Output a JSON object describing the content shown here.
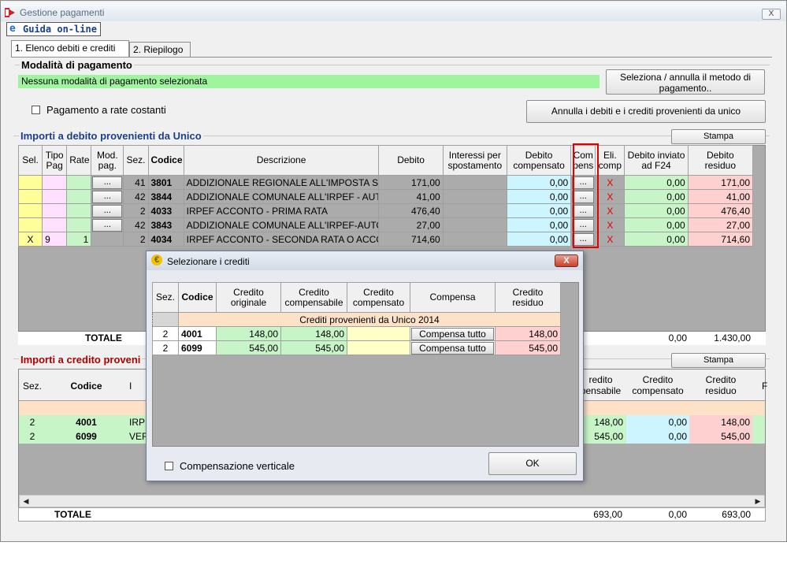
{
  "window": {
    "title": "Gestione pagamenti",
    "close_label": "X"
  },
  "toolbar": {
    "guida_label": "Guida on-line"
  },
  "tabs": [
    {
      "label": "1. Elenco debiti e crediti",
      "active": true
    },
    {
      "label": "2. Riepilogo",
      "active": false
    }
  ],
  "payment_mode": {
    "group_title": "Modalità di pagamento",
    "status_text": "Nessuna modalità di pagamento selezionata",
    "select_button": "Seleziona / annulla il metodo di pagamento..",
    "rate_costanti_label": "Pagamento a rate costanti",
    "annulla_button": "Annulla i debiti e i crediti provenienti da unico"
  },
  "debit": {
    "group_title": "Importi a debito provenienti da Unico",
    "stampa_label": "Stampa",
    "headers": [
      "Sel.",
      "Tipo Pag",
      "Rate",
      "Mod. pag.",
      "Sez.",
      "Codice",
      "Descrizione",
      "Debito",
      "Interessi per spostamento",
      "Debito compensato",
      "Com pens",
      "Eli. comp",
      "Debito inviato ad F24",
      "Debito residuo"
    ],
    "rows": [
      {
        "sel": "",
        "tipo": "",
        "rate": "",
        "mod": "...",
        "sez": "41",
        "codice": "3801",
        "descr": "ADDIZIONALE REGIONALE ALL'IMPOSTA SU",
        "debito": "171,00",
        "interessi": "",
        "compensato": "0,00",
        "compensa": "...",
        "eli": "X",
        "inviato": "0,00",
        "residuo": "171,00"
      },
      {
        "sel": "",
        "tipo": "",
        "rate": "",
        "mod": "...",
        "sez": "42",
        "codice": "3844",
        "descr": "ADDIZIONALE COMUNALE ALL'IRPEF - AUTO",
        "debito": "41,00",
        "interessi": "",
        "compensato": "0,00",
        "compensa": "...",
        "eli": "X",
        "inviato": "0,00",
        "residuo": "41,00"
      },
      {
        "sel": "",
        "tipo": "",
        "rate": "",
        "mod": "...",
        "sez": "2",
        "codice": "4033",
        "descr": "IRPEF ACCONTO - PRIMA RATA",
        "debito": "476,40",
        "interessi": "",
        "compensato": "0,00",
        "compensa": "...",
        "eli": "X",
        "inviato": "0,00",
        "residuo": "476,40"
      },
      {
        "sel": "",
        "tipo": "",
        "rate": "",
        "mod": "...",
        "sez": "42",
        "codice": "3843",
        "descr": "ADDIZIONALE COMUNALE ALL'IRPEF-AUTOT",
        "debito": "27,00",
        "interessi": "",
        "compensato": "0,00",
        "compensa": "...",
        "eli": "X",
        "inviato": "0,00",
        "residuo": "27,00"
      },
      {
        "sel": "X",
        "tipo": "9",
        "rate": "1",
        "mod": "",
        "sez": "2",
        "codice": "4034",
        "descr": "IRPEF ACCONTO - SECONDA RATA O ACCON",
        "debito": "714,60",
        "interessi": "",
        "compensato": "0,00",
        "compensa": "...",
        "eli": "X",
        "inviato": "0,00",
        "residuo": "714,60"
      }
    ],
    "totale_label": "TOTALE",
    "totale_inviato": "0,00",
    "totale_residuo": "1.430,00"
  },
  "credit": {
    "group_title": "Importi a credito proveni",
    "stampa_label": "Stampa",
    "headers": {
      "sez": "Sez.",
      "codice": "Codice",
      "descr": "I",
      "compensabile": "redito pensabile",
      "compensato": "Credito compensato",
      "residuo": "Credito residuo",
      "extra": "F"
    },
    "rows": [
      {
        "sez": "2",
        "codice": "4001",
        "descr": "IRPE",
        "compensabile": "148,00",
        "compensato": "0,00",
        "residuo": "148,00"
      },
      {
        "sez": "2",
        "codice": "6099",
        "descr": "VER",
        "compensabile": "545,00",
        "compensato": "0,00",
        "residuo": "545,00"
      }
    ],
    "totale_label": "TOTALE",
    "totale_compensabile": "693,00",
    "totale_compensato": "0,00",
    "totale_residuo": "693,00"
  },
  "dialog": {
    "title": "Selezionare i crediti",
    "close_label": "X",
    "headers": [
      "Sez.",
      "Codice",
      "Credito originale",
      "Credito compensabile",
      "Credito compensato",
      "Compensa",
      "Credito residuo"
    ],
    "group_row": "Crediti provenienti da Unico 2014",
    "rows": [
      {
        "sez": "2",
        "codice": "4001",
        "originale": "148,00",
        "compensabile": "148,00",
        "compensato": "",
        "button": "Compensa tutto",
        "residuo": "148,00"
      },
      {
        "sez": "2",
        "codice": "6099",
        "originale": "545,00",
        "compensabile": "545,00",
        "compensato": "",
        "button": "Compensa tutto",
        "residuo": "545,00"
      }
    ],
    "vertical_label": "Compensazione verticale",
    "ok_label": "OK"
  },
  "colors": {
    "highlight_red": "#e00000",
    "green_bar": "#9ef59e"
  }
}
